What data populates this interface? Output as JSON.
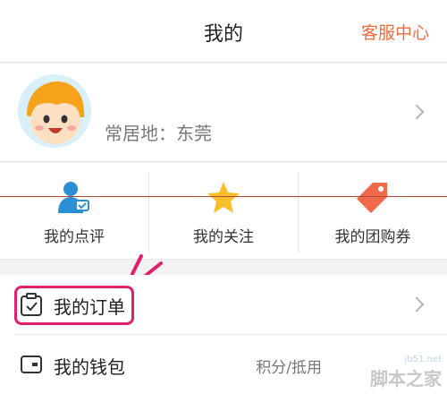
{
  "header": {
    "title": "我的",
    "service_label": "客服中心"
  },
  "profile": {
    "residence": "常居地：东莞"
  },
  "quick_actions": [
    {
      "label": "我的点评"
    },
    {
      "label": "我的关注"
    },
    {
      "label": "我的团购券"
    }
  ],
  "list": [
    {
      "label": "我的订单"
    },
    {
      "label": "我的钱包",
      "value": "积分/抵用"
    }
  ],
  "watermark": {
    "url": "jb51.net",
    "name": "脚本之家"
  },
  "colors": {
    "accent": "#f06a3c",
    "highlight": "#e0206a",
    "user_icon": "#2b8fd6",
    "star": "#f8bf2a",
    "coupon": "#f0694a"
  }
}
